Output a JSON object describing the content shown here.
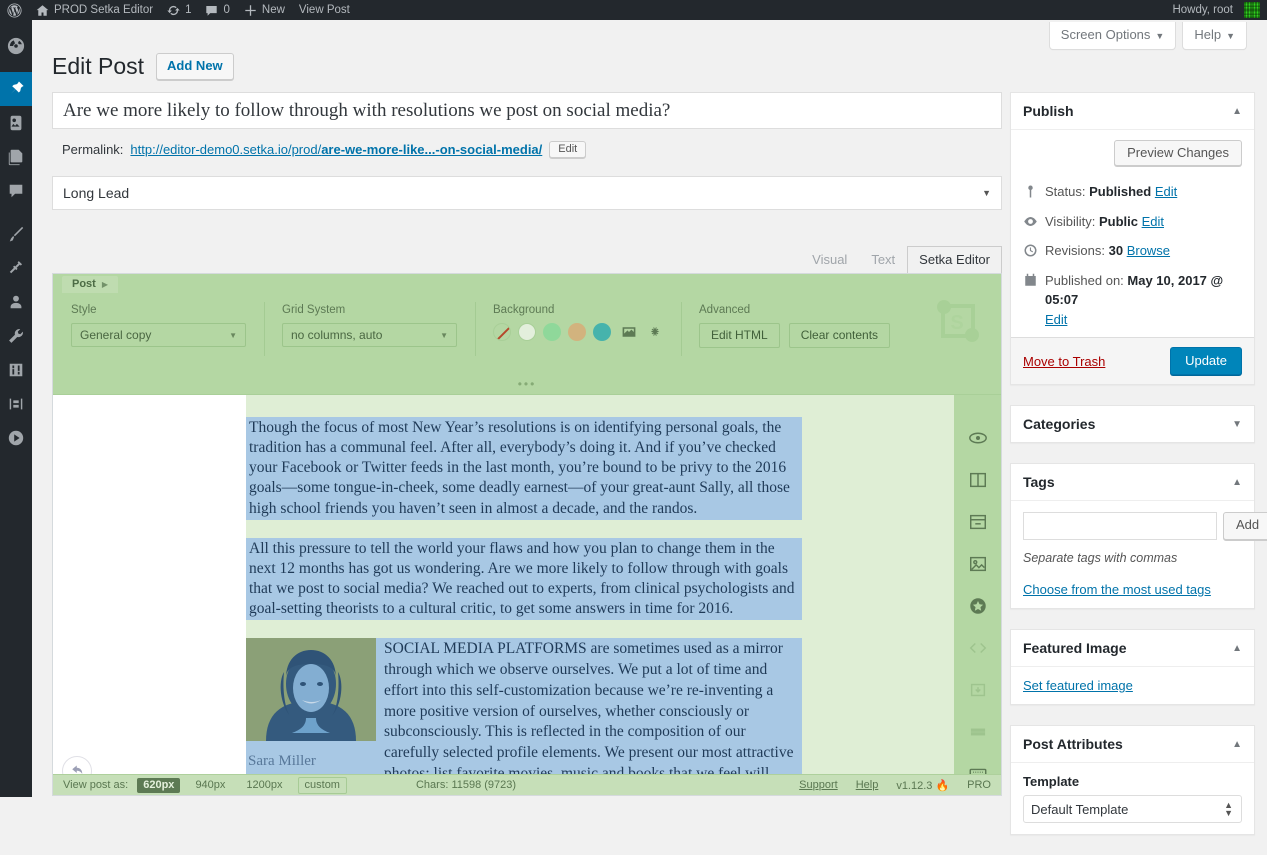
{
  "adminbar": {
    "site_name": "PROD Setka Editor",
    "updates_count": "1",
    "comments_count": "0",
    "new_label": "New",
    "view_post_label": "View Post",
    "howdy": "Howdy, root"
  },
  "adminmenu": {
    "items": [
      {
        "name": "dashboard",
        "icon": "dashboard-icon"
      },
      {
        "name": "posts",
        "icon": "pin-icon",
        "current": true
      },
      {
        "name": "media",
        "icon": "media-icon"
      },
      {
        "name": "pages",
        "icon": "pages-icon"
      },
      {
        "name": "comments",
        "icon": "comment-icon"
      },
      {
        "name": "appearance",
        "icon": "brush-icon"
      },
      {
        "name": "plugins",
        "icon": "plugin-icon"
      },
      {
        "name": "users",
        "icon": "user-icon"
      },
      {
        "name": "tools",
        "icon": "wrench-icon"
      },
      {
        "name": "settings",
        "icon": "sliders-icon"
      },
      {
        "name": "setka-editor",
        "icon": "setka-icon"
      },
      {
        "name": "media-player",
        "icon": "play-icon"
      }
    ]
  },
  "screen_meta": {
    "screen_options": "Screen Options",
    "help": "Help",
    "caret": "▼"
  },
  "header": {
    "page_title": "Edit Post",
    "add_new": "Add New"
  },
  "post": {
    "title": "Are we more likely to follow through with resolutions we post on social media?",
    "permalink_label": "Permalink:",
    "permalink_prefix": "http://editor-demo0.setka.io/prod/",
    "permalink_slug": "are-we-more-like...-on-social-media/",
    "permalink_edit": "Edit",
    "lead_select_value": "Long Lead"
  },
  "editor_tabs": [
    {
      "label": "Visual",
      "active": false
    },
    {
      "label": "Text",
      "active": false
    },
    {
      "label": "Setka Editor",
      "active": true
    }
  ],
  "setka": {
    "tab_post": "Post",
    "style_label": "Style",
    "style_value": "General copy",
    "grid_label": "Grid System",
    "grid_value": "no columns, auto",
    "background_label": "Background",
    "advanced_label": "Advanced",
    "edit_html": "Edit HTML",
    "clear_contents": "Clear contents",
    "swatch_colors": [
      "none",
      "#e3efdc",
      "#8fd89a",
      "#d2b37e",
      "#46b3ac"
    ],
    "logo_text": "S",
    "side_tools": [
      {
        "name": "preview-eye-icon"
      },
      {
        "name": "columns-icon"
      },
      {
        "name": "card-icon"
      },
      {
        "name": "image-icon"
      },
      {
        "name": "star-icon"
      },
      {
        "name": "code-icon"
      },
      {
        "name": "download-icon"
      },
      {
        "name": "lines-icon"
      },
      {
        "name": "keyboard-icon"
      }
    ],
    "status": {
      "view_post_as": "View post as:",
      "widths": [
        {
          "label": "620px",
          "active": true
        },
        {
          "label": "940px",
          "active": false
        },
        {
          "label": "1200px",
          "active": false
        },
        {
          "label": "custom",
          "active": false,
          "boxed": true
        }
      ],
      "chars": "Chars: 11598 (9723)",
      "support": "Support",
      "help": "Help",
      "version": "v1.12.3 🔥",
      "pro": "PRO"
    }
  },
  "content": {
    "paragraph1": "Though the focus of most New Year’s resolutions is on identifying personal goals, the tradition has a communal feel. After all, everybody’s doing it. And if you’ve checked your Facebook or Twitter feeds in the last month, you’re bound to be privy to the 2016 goals—some tongue-in-cheek, some deadly earnest—of your great-aunt Sally, all those high school friends you haven’t seen in almost a decade, and the randos.",
    "paragraph2": "All this pressure to tell the world your flaws and how you plan to change them in the next 12 months has got us wondering. Are we more likely to follow through with goals that we post to social media? We reached out to experts, from clinical psychologists and goal-setting theorists to a cultural critic, to get some answers in time for 2016.",
    "paragraph3": "SOCIAL MEDIA PLATFORMS are sometimes used as a mirror through which we observe ourselves. We put a lot of time and effort into this self-customization because we’re re-inventing a more positive version of ourselves, whether consciously or subconsciously. This is reflected in the composition of our carefully selected profile elements. We present our most attractive photos; list favorite movies, music and books that we feel will impress others; and send friend requests to not only our friends and family, but to the people we",
    "figure_caption": "Sara Miller"
  },
  "sidebar": {
    "publish": {
      "title": "Publish",
      "preview_changes": "Preview Changes",
      "status_label": "Status:",
      "status_value": "Published",
      "status_edit": "Edit",
      "visibility_label": "Visibility:",
      "visibility_value": "Public",
      "visibility_edit": "Edit",
      "revisions_label": "Revisions:",
      "revisions_value": "30",
      "revisions_browse": "Browse",
      "published_label": "Published on:",
      "published_value": "May 10, 2017 @ 05:07",
      "published_edit": "Edit",
      "move_to_trash": "Move to Trash",
      "update": "Update"
    },
    "categories": {
      "title": "Categories"
    },
    "tags": {
      "title": "Tags",
      "input_value": "",
      "add_button": "Add",
      "hint": "Separate tags with commas",
      "choose_link": "Choose from the most used tags"
    },
    "featured_image": {
      "title": "Featured Image",
      "set_link": "Set featured image"
    },
    "post_attributes": {
      "title": "Post Attributes",
      "template_label": "Template",
      "template_value": "Default Template"
    }
  },
  "colors": {
    "admin_dark": "#23282d",
    "wp_blue": "#0073aa",
    "primary_button": "#0085ba",
    "setka_green": "#b4d7a3",
    "selection_blue": "#a8c8e4",
    "trash_red": "#a00"
  }
}
